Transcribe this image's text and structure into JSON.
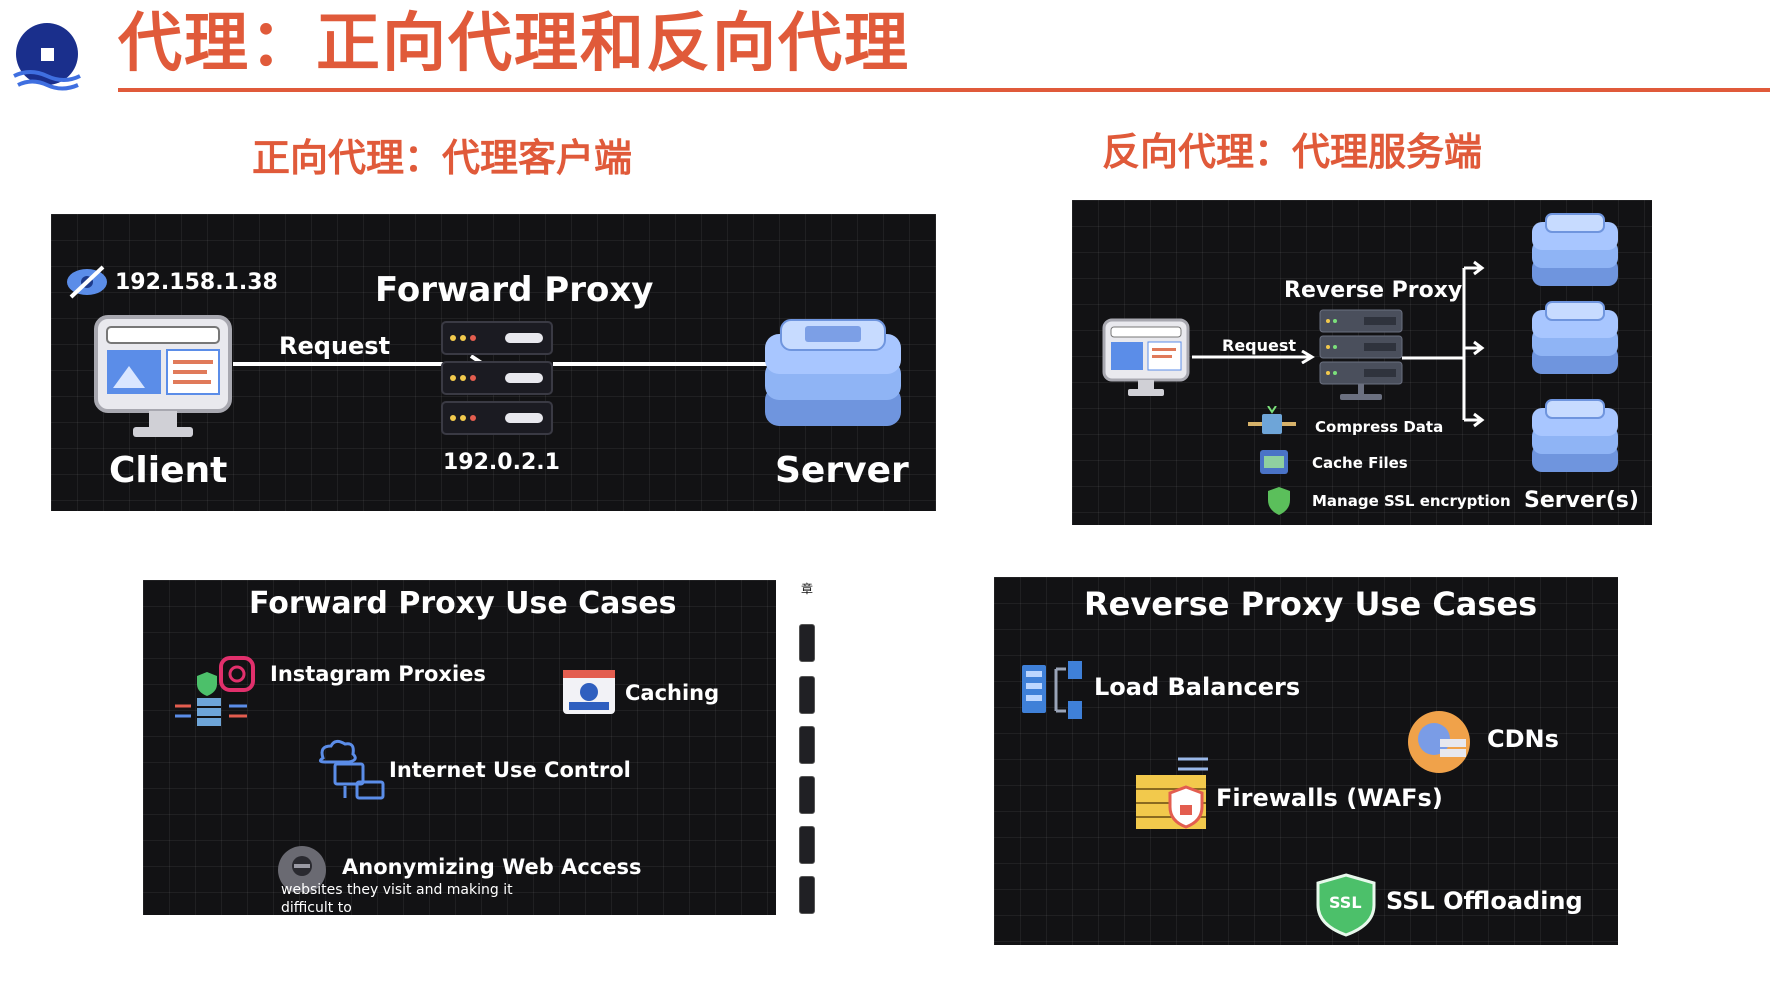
{
  "slide": {
    "title": "代理：正向代理和反向代理",
    "left_heading": "正向代理：代理客户端",
    "right_heading": "反向代理：代理服务端"
  },
  "forward_diagram": {
    "client_ip": "192.158.1.38",
    "proxy_title": "Forward Proxy",
    "request_label": "Request",
    "proxy_ip": "192.0.2.1",
    "client_label": "Client",
    "server_label": "Server"
  },
  "reverse_diagram": {
    "proxy_title": "Reverse Proxy",
    "request_label": "Request",
    "features": [
      "Compress Data",
      "Cache Files",
      "Manage SSL encryption"
    ],
    "servers_label": "Server(s)"
  },
  "forward_use_cases": {
    "title": "Forward Proxy Use Cases",
    "instagram": "Instagram Proxies",
    "caching": "Caching",
    "internet": "Internet Use Control",
    "anonymizing": "Anonymizing Web Access",
    "caption_line1": "websites they visit and making it",
    "caption_line2": "difficult to",
    "side_label": "章"
  },
  "reverse_use_cases": {
    "title": "Reverse Proxy Use Cases",
    "load_balancers": "Load Balancers",
    "cdns": "CDNs",
    "firewalls": "Firewalls (WAFs)",
    "ssl": "SSL Offloading",
    "ssl_badge": "SSL"
  },
  "colors": {
    "accent": "#e05a3a",
    "logo_blue": "#1a2f8c",
    "panel_bg": "#121214",
    "server_blue": "#8fb4f5"
  }
}
